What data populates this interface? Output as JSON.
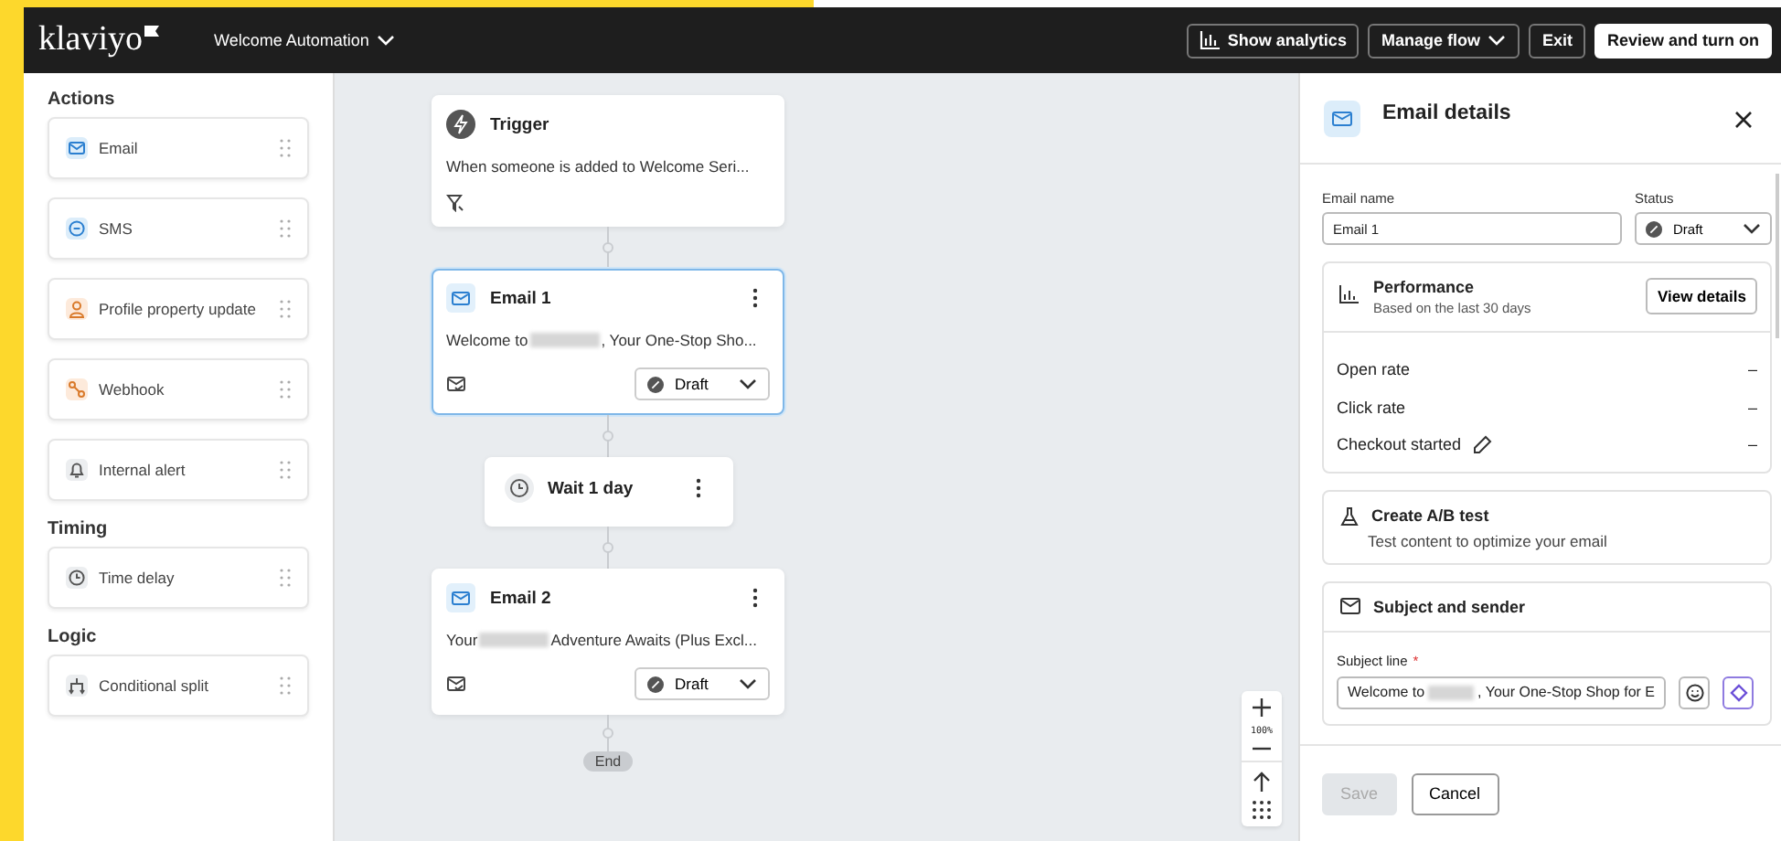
{
  "header": {
    "logo": "klaviyo",
    "flow_name": "Welcome Automation",
    "buttons": [
      {
        "label": "Show analytics",
        "kind": "analytics"
      },
      {
        "label": "Manage flow",
        "kind": "menu"
      },
      {
        "label": "Exit",
        "kind": "plain"
      },
      {
        "label": "Review and turn on",
        "kind": "primary"
      }
    ]
  },
  "sidebar": {
    "sections": [
      {
        "title": "Actions",
        "items": [
          {
            "label": "Email",
            "kind": "email"
          },
          {
            "label": "SMS",
            "kind": "sms"
          },
          {
            "label": "Profile property update",
            "kind": "profile"
          },
          {
            "label": "Webhook",
            "kind": "webhook"
          },
          {
            "label": "Internal alert",
            "kind": "alert"
          }
        ]
      },
      {
        "title": "Timing",
        "items": [
          {
            "label": "Time delay",
            "kind": "delay"
          }
        ]
      },
      {
        "title": "Logic",
        "items": [
          {
            "label": "Conditional split",
            "kind": "split"
          }
        ]
      }
    ]
  },
  "canvas": {
    "nodes": [
      {
        "kind": "trigger",
        "title": "Trigger",
        "description": "When someone is added to Welcome Seri...",
        "selected": false
      },
      {
        "kind": "email",
        "title": "Email 1",
        "preview_start": "Welcome to",
        "preview_end": ", Your One-Stop Sho...",
        "status": "Draft",
        "selected": true
      },
      {
        "kind": "wait",
        "title": "Wait 1 day",
        "selected": false
      },
      {
        "kind": "email",
        "title": "Email 2",
        "preview_start": "Your",
        "preview_end": "Adventure Awaits (Plus Excl...",
        "status": "Draft",
        "selected": false
      }
    ],
    "end_label": "End",
    "zoom_level": "100%"
  },
  "panel": {
    "title": "Email details",
    "name_label": "Email name",
    "name_value": "Email 1",
    "status_label": "Status",
    "status_value": "Draft",
    "performance": {
      "title": "Performance",
      "subtitle": "Based on the last 30 days",
      "button": "View details",
      "metrics": [
        {
          "label": "Open rate",
          "value": "–",
          "editable": false
        },
        {
          "label": "Click rate",
          "value": "–",
          "editable": false
        },
        {
          "label": "Checkout started",
          "value": "–",
          "editable": true
        }
      ]
    },
    "ab_test": {
      "title": "Create A/B test",
      "subtitle": "Test content to optimize your email"
    },
    "subject": {
      "title": "Subject and sender",
      "field_label": "Subject line",
      "required_mark": "*",
      "value_start": "Welcome to",
      "value_end": ", Your One-Stop Shop for E"
    },
    "footer": {
      "save": "Save",
      "save_disabled": true,
      "cancel": "Cancel"
    }
  }
}
